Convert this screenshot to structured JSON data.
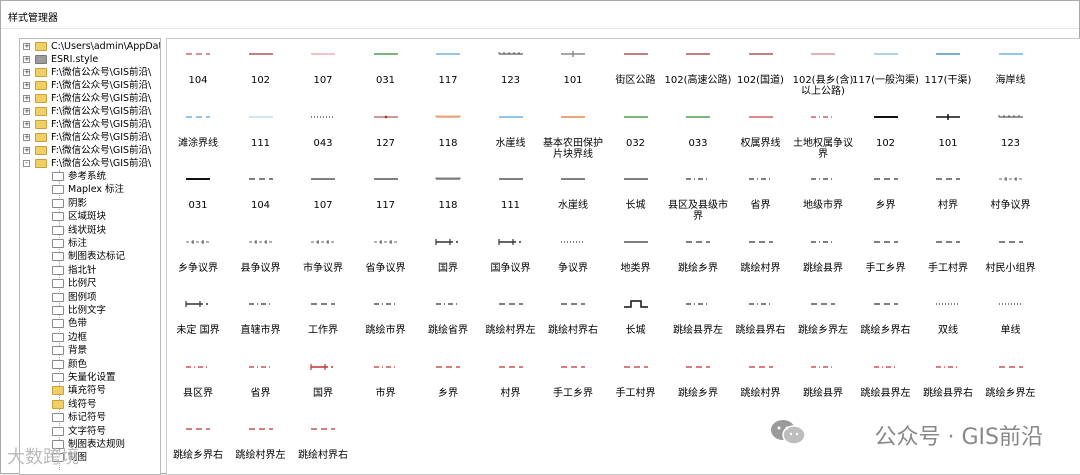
{
  "window": {
    "title": "样式管理器"
  },
  "tree": [
    {
      "label": "C:\\Users\\admin\\AppData\\",
      "type": "folder",
      "expand": "+"
    },
    {
      "label": "ESRI.style",
      "type": "gray",
      "expand": "+"
    },
    {
      "label": "F:\\微信公众号\\GIS前沿\\",
      "type": "folder",
      "expand": "+"
    },
    {
      "label": "F:\\微信公众号\\GIS前沿\\",
      "type": "folder",
      "expand": "+"
    },
    {
      "label": "F:\\微信公众号\\GIS前沿\\",
      "type": "folder",
      "expand": "+"
    },
    {
      "label": "F:\\微信公众号\\GIS前沿\\",
      "type": "folder",
      "expand": "+"
    },
    {
      "label": "F:\\微信公众号\\GIS前沿\\",
      "type": "folder",
      "expand": "+"
    },
    {
      "label": "F:\\微信公众号\\GIS前沿\\",
      "type": "folder",
      "expand": "+"
    },
    {
      "label": "F:\\微信公众号\\GIS前沿\\",
      "type": "folder",
      "expand": "+"
    },
    {
      "label": "F:\\微信公众号\\GIS前沿\\",
      "type": "folder",
      "expand": "-"
    }
  ],
  "tree_children": [
    {
      "label": "参考系统",
      "type": "white"
    },
    {
      "label": "Maplex 标注",
      "type": "white"
    },
    {
      "label": "阴影",
      "type": "white"
    },
    {
      "label": "区域斑块",
      "type": "white"
    },
    {
      "label": "线状斑块",
      "type": "white"
    },
    {
      "label": "标注",
      "type": "white"
    },
    {
      "label": "制图表达标记",
      "type": "white"
    },
    {
      "label": "指北针",
      "type": "white"
    },
    {
      "label": "比例尺",
      "type": "white"
    },
    {
      "label": "图例项",
      "type": "white"
    },
    {
      "label": "比例文字",
      "type": "white"
    },
    {
      "label": "色带",
      "type": "white"
    },
    {
      "label": "边框",
      "type": "white"
    },
    {
      "label": "背景",
      "type": "white"
    },
    {
      "label": "颜色",
      "type": "white"
    },
    {
      "label": "矢量化设置",
      "type": "white"
    },
    {
      "label": "填充符号",
      "type": "yellow"
    },
    {
      "label": "线符号",
      "type": "yellow"
    },
    {
      "label": "标记符号",
      "type": "white"
    },
    {
      "label": "文字符号",
      "type": "white"
    },
    {
      "label": "制图表达规则",
      "type": "white"
    },
    {
      "label": "制图",
      "type": "white"
    }
  ],
  "symbols": [
    [
      {
        "label": "104",
        "color": "#c0504d",
        "style": "dash"
      },
      {
        "label": "102",
        "color": "#a0302d",
        "style": "solid"
      },
      {
        "label": "107",
        "color": "#e8a0a0",
        "style": "solid"
      },
      {
        "label": "031",
        "color": "#2e8b2e",
        "style": "solid"
      },
      {
        "label": "117",
        "color": "#4fa3d9",
        "style": "solid"
      },
      {
        "label": "123",
        "color": "#333333",
        "style": "tick"
      },
      {
        "label": "101",
        "color": "#888888",
        "style": "crossline"
      },
      {
        "label": "街区公路",
        "color": "#a0303a",
        "style": "solid"
      },
      {
        "label": "102(高速公路)",
        "color": "#a03030",
        "style": "solid"
      },
      {
        "label": "102(国道)",
        "color": "#a03030",
        "style": "solid"
      },
      {
        "label": "102(县乡(含)以上公路)",
        "color": "#d08080",
        "style": "solid"
      },
      {
        "label": "117(一般沟渠)",
        "color": "#7ab8e0",
        "style": "solid"
      },
      {
        "label": "117(干渠)",
        "color": "#2e7fb8",
        "style": "solid"
      },
      {
        "label": "海岸线",
        "color": "#4fa3d9",
        "style": "solid"
      }
    ],
    [
      {
        "label": "滩涂界线",
        "color": "#4fa3d9",
        "style": "dash"
      },
      {
        "label": "111",
        "color": "#b0d8f0",
        "style": "solid"
      },
      {
        "label": "043",
        "color": "#333333",
        "style": "dots"
      },
      {
        "label": "127",
        "color": "#a03030",
        "style": "dotline"
      },
      {
        "label": "118",
        "color": "#e07030",
        "style": "hatch"
      },
      {
        "label": "水崖线",
        "color": "#4fa3d9",
        "style": "solid"
      },
      {
        "label": "基本农田保护片块界线",
        "color": "#e07030",
        "style": "solid"
      },
      {
        "label": "032",
        "color": "#2e8b2e",
        "style": "solid"
      },
      {
        "label": "033",
        "color": "#2e8b2e",
        "style": "solid"
      },
      {
        "label": "权属界线",
        "color": "#d04040",
        "style": "solid"
      },
      {
        "label": "土地权属争议界",
        "color": "#d04040",
        "style": "dashdot"
      },
      {
        "label": "102",
        "color": "#111111",
        "style": "thick"
      },
      {
        "label": "101",
        "color": "#111111",
        "style": "crossline"
      },
      {
        "label": "123",
        "color": "#333333",
        "style": "tick"
      }
    ],
    [
      {
        "label": "031",
        "color": "#111111",
        "style": "thick"
      },
      {
        "label": "104",
        "color": "#333333",
        "style": "dash"
      },
      {
        "label": "107",
        "color": "#333333",
        "style": "solid"
      },
      {
        "label": "117",
        "color": "#333333",
        "style": "solid"
      },
      {
        "label": "118",
        "color": "#333333",
        "style": "hatch"
      },
      {
        "label": "111",
        "color": "#333333",
        "style": "solid"
      },
      {
        "label": "水崖线",
        "color": "#333333",
        "style": "solid"
      },
      {
        "label": "长城",
        "color": "#333333",
        "style": "solid"
      },
      {
        "label": "县区及县级市界",
        "color": "#333333",
        "style": "dashdot"
      },
      {
        "label": "省界",
        "color": "#333333",
        "style": "dashdot"
      },
      {
        "label": "地级市界",
        "color": "#333333",
        "style": "dashdot"
      },
      {
        "label": "乡界",
        "color": "#333333",
        "style": "dash"
      },
      {
        "label": "村界",
        "color": "#333333",
        "style": "dash"
      },
      {
        "label": "村争议界",
        "color": "#333333",
        "style": "cross"
      }
    ],
    [
      {
        "label": "乡争议界",
        "color": "#333333",
        "style": "cross"
      },
      {
        "label": "县争议界",
        "color": "#333333",
        "style": "cross"
      },
      {
        "label": "市争议界",
        "color": "#333333",
        "style": "cross"
      },
      {
        "label": "省争议界",
        "color": "#333333",
        "style": "cross"
      },
      {
        "label": "国界",
        "color": "#333333",
        "style": "border"
      },
      {
        "label": "国争议界",
        "color": "#333333",
        "style": "border"
      },
      {
        "label": "争议界",
        "color": "#333333",
        "style": "dots"
      },
      {
        "label": "地类界",
        "color": "#333333",
        "style": "solid"
      },
      {
        "label": "跳绘乡界",
        "color": "#333333",
        "style": "dash"
      },
      {
        "label": "跳绘村界",
        "color": "#333333",
        "style": "dash"
      },
      {
        "label": "跳绘县界",
        "color": "#333333",
        "style": "dashdot"
      },
      {
        "label": "手工乡界",
        "color": "#333333",
        "style": "dash"
      },
      {
        "label": "手工村界",
        "color": "#333333",
        "style": "dash"
      },
      {
        "label": "村民小组界",
        "color": "#333333",
        "style": "dash"
      }
    ],
    [
      {
        "label": "未定 国界",
        "color": "#333333",
        "style": "border"
      },
      {
        "label": "直辖市界",
        "color": "#333333",
        "style": "dashdot"
      },
      {
        "label": "工作界",
        "color": "#333333",
        "style": "dash"
      },
      {
        "label": "跳绘市界",
        "color": "#333333",
        "style": "dashdot"
      },
      {
        "label": "跳绘省界",
        "color": "#333333",
        "style": "dashdot"
      },
      {
        "label": "跳绘村界左",
        "color": "#333333",
        "style": "dash"
      },
      {
        "label": "跳绘村界右",
        "color": "#333333",
        "style": "dash"
      },
      {
        "label": "长城",
        "color": "#111111",
        "style": "wall"
      },
      {
        "label": "跳绘县界左",
        "color": "#333333",
        "style": "dashdot"
      },
      {
        "label": "跳绘县界右",
        "color": "#333333",
        "style": "dashdot"
      },
      {
        "label": "跳绘乡界左",
        "color": "#333333",
        "style": "dash"
      },
      {
        "label": "跳绘乡界右",
        "color": "#333333",
        "style": "dash"
      },
      {
        "label": "双线",
        "color": "#333333",
        "style": "dots"
      },
      {
        "label": "单线",
        "color": "#333333",
        "style": "dots"
      }
    ],
    [
      {
        "label": "县区界",
        "color": "#c03030",
        "style": "dashdot"
      },
      {
        "label": "省界",
        "color": "#c03030",
        "style": "dashdot"
      },
      {
        "label": "国界",
        "color": "#c03030",
        "style": "border"
      },
      {
        "label": "市界",
        "color": "#c03030",
        "style": "dashdot"
      },
      {
        "label": "乡界",
        "color": "#c03030",
        "style": "dash"
      },
      {
        "label": "村界",
        "color": "#c03030",
        "style": "dash"
      },
      {
        "label": "手工乡界",
        "color": "#c03030",
        "style": "dash"
      },
      {
        "label": "手工村界",
        "color": "#c03030",
        "style": "dash"
      },
      {
        "label": "跳绘乡界",
        "color": "#c03030",
        "style": "dash"
      },
      {
        "label": "跳绘村界",
        "color": "#c03030",
        "style": "dash"
      },
      {
        "label": "跳绘县界",
        "color": "#c03030",
        "style": "dashdot"
      },
      {
        "label": "跳绘县界左",
        "color": "#c03030",
        "style": "dashdot"
      },
      {
        "label": "跳绘县界右",
        "color": "#c03030",
        "style": "dashdot"
      },
      {
        "label": "跳绘乡界左",
        "color": "#c03030",
        "style": "dash"
      }
    ],
    [
      {
        "label": "跳绘乡界右",
        "color": "#c03030",
        "style": "dash"
      },
      {
        "label": "跳绘村界左",
        "color": "#c03030",
        "style": "dash"
      },
      {
        "label": "跳绘村界右",
        "color": "#c03030",
        "style": "dash"
      }
    ]
  ],
  "watermark": {
    "text": "公众号 · GIS前沿",
    "text2": "大数跨境"
  }
}
